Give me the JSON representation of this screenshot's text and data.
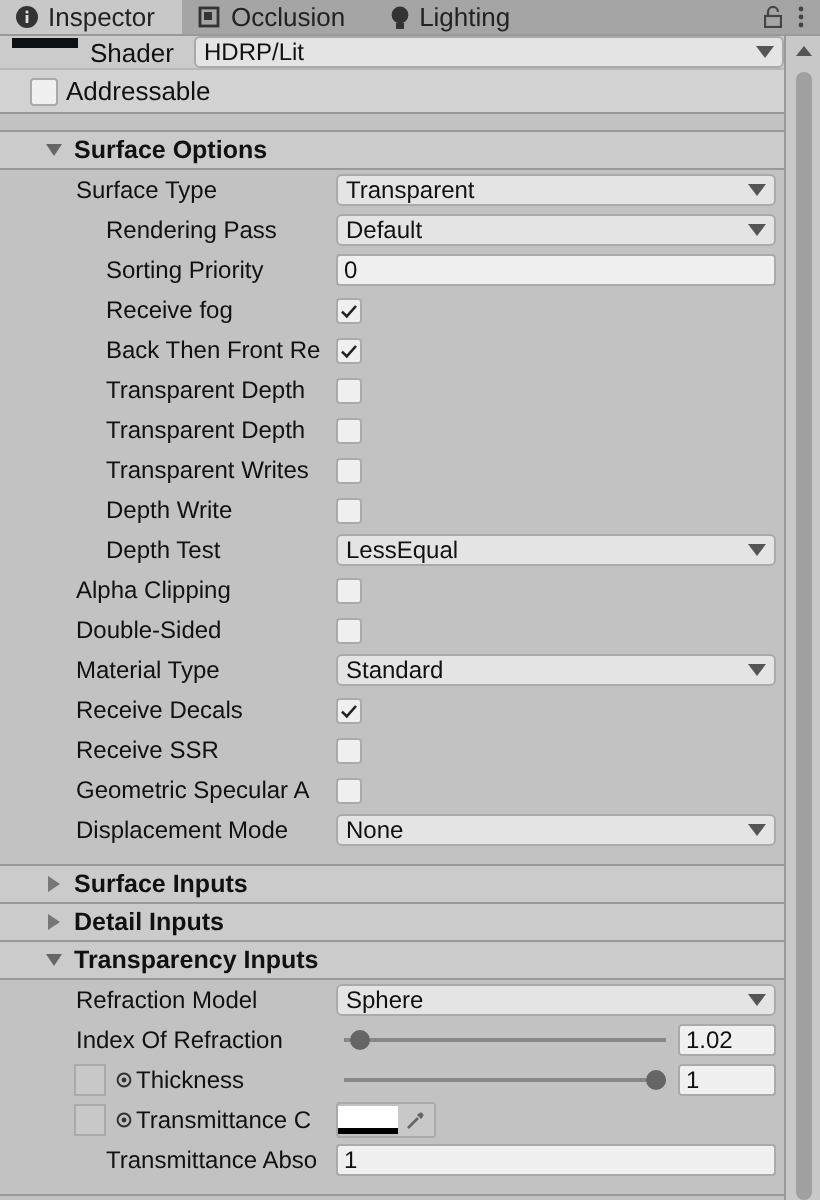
{
  "tabs": [
    {
      "label": "Inspector",
      "selected": true
    },
    {
      "label": "Occlusion",
      "selected": false
    },
    {
      "label": "Lighting",
      "selected": false
    }
  ],
  "material": {
    "shader_label": "Shader",
    "shader": "HDRP/Lit",
    "addressable": {
      "label": "Addressable",
      "checked": false
    }
  },
  "sections": [
    {
      "title": "Surface Options",
      "expanded": true,
      "rows": [
        {
          "kind": "dropdown",
          "label": "Surface Type",
          "value": "Transparent",
          "children": [
            {
              "kind": "dropdown",
              "label": "Rendering Pass",
              "value": "Default"
            },
            {
              "kind": "number",
              "label": "Sorting Priority",
              "value": "0"
            },
            {
              "kind": "checkbox",
              "label": "Receive fog",
              "checked": true
            },
            {
              "kind": "checkbox",
              "label": "Back Then Front Re",
              "checked": true
            },
            {
              "kind": "checkbox",
              "label": "Transparent Depth",
              "checked": false
            },
            {
              "kind": "checkbox",
              "label": "Transparent Depth",
              "checked": false
            },
            {
              "kind": "checkbox",
              "label": "Transparent Writes",
              "checked": false
            },
            {
              "kind": "checkbox",
              "label": "Depth Write",
              "checked": false
            },
            {
              "kind": "dropdown",
              "label": "Depth Test",
              "value": "LessEqual"
            }
          ]
        },
        {
          "kind": "checkbox",
          "label": "Alpha Clipping",
          "checked": false
        },
        {
          "kind": "checkbox",
          "label": "Double-Sided",
          "checked": false
        },
        {
          "kind": "dropdown",
          "label": "Material Type",
          "value": "Standard"
        },
        {
          "kind": "checkbox",
          "label": "Receive Decals",
          "checked": true
        },
        {
          "kind": "checkbox",
          "label": "Receive SSR",
          "checked": false
        },
        {
          "kind": "checkbox",
          "label": "Geometric Specular A",
          "checked": false
        },
        {
          "kind": "dropdown",
          "label": "Displacement Mode",
          "value": "None"
        }
      ]
    },
    {
      "title": "Surface Inputs",
      "expanded": false
    },
    {
      "title": "Detail Inputs",
      "expanded": false
    },
    {
      "title": "Transparency Inputs",
      "expanded": true,
      "rows": [
        {
          "kind": "dropdown",
          "label": "Refraction Model",
          "value": "Sphere"
        },
        {
          "kind": "slider",
          "label": "Index Of Refraction",
          "level": 0.02,
          "value": "1.02"
        },
        {
          "kind": "slider",
          "label": "Thickness",
          "level": 1,
          "value": "1",
          "texture_slot": true
        },
        {
          "kind": "color",
          "label": "Transmittance C",
          "color": "#ffffff",
          "texture_slot": true,
          "children": [
            {
              "kind": "number",
              "label": "Transmittance Abso",
              "value": "1"
            }
          ]
        }
      ]
    }
  ]
}
